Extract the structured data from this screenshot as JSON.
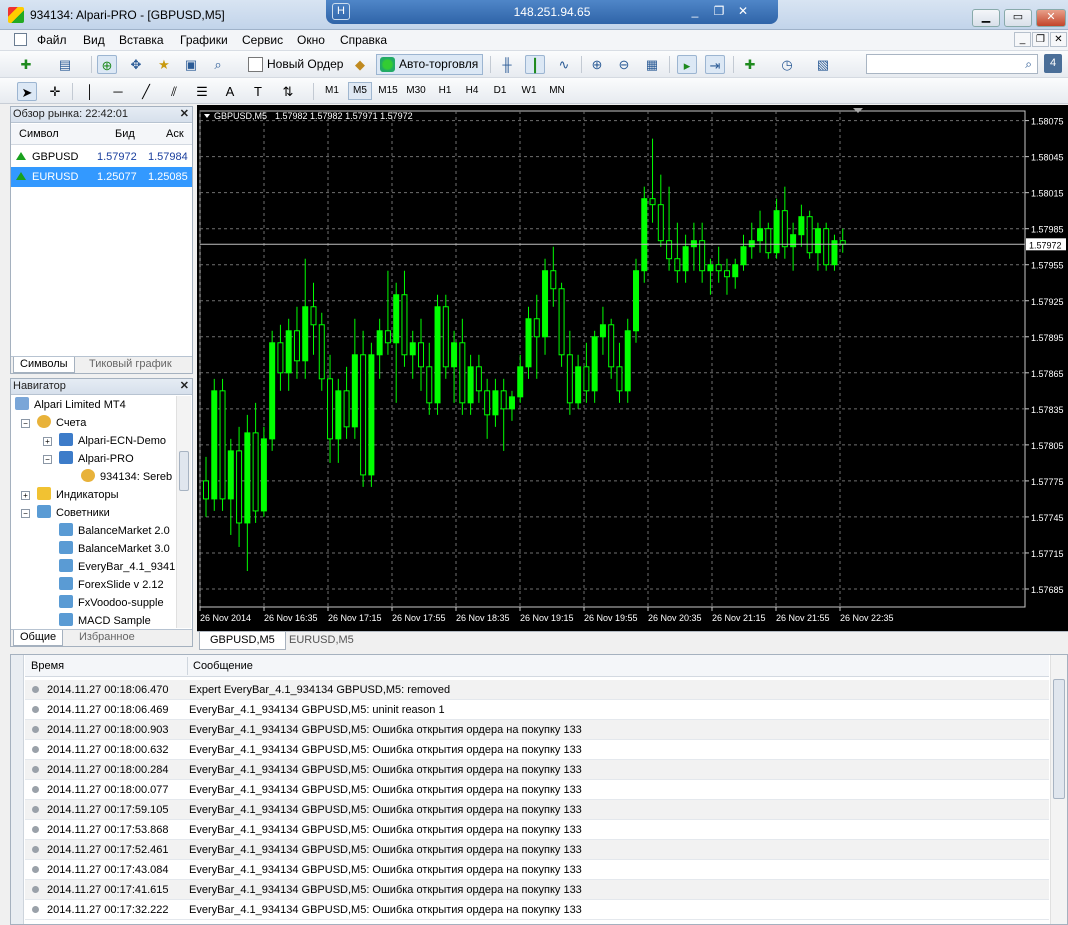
{
  "window": {
    "title": "934134: Alpari-PRO - [GBPUSD,M5]",
    "remote_ip": "148.251.94.65"
  },
  "menu": [
    "Файл",
    "Вид",
    "Вставка",
    "Графики",
    "Сервис",
    "Окно",
    "Справка"
  ],
  "toolbar": {
    "new_order": "Новый Ордер",
    "auto_trading": "Авто-торговля",
    "badge": "4"
  },
  "timeframes": [
    "M1",
    "M5",
    "M15",
    "M30",
    "H1",
    "H4",
    "D1",
    "W1",
    "MN"
  ],
  "active_timeframe": "M5",
  "market_watch": {
    "title": "Обзор рынка: 22:42:01",
    "columns": {
      "symbol": "Символ",
      "bid": "Бид",
      "ask": "Аск"
    },
    "rows": [
      {
        "symbol": "GBPUSD",
        "bid": "1.57972",
        "ask": "1.57984"
      },
      {
        "symbol": "EURUSD",
        "bid": "1.25077",
        "ask": "1.25085"
      }
    ],
    "tabs": [
      "Символы",
      "Тиковый график"
    ]
  },
  "navigator": {
    "title": "Навигатор",
    "items": [
      {
        "label": "Alpari Limited MT4",
        "icon": "terminal-icon"
      },
      {
        "label": "Счета",
        "icon": "accounts-icon"
      },
      {
        "label": "Alpari-ECN-Demo",
        "icon": "server-icon"
      },
      {
        "label": "Alpari-PRO",
        "icon": "server-icon"
      },
      {
        "label": "934134: Sereb",
        "icon": "account-icon"
      },
      {
        "label": "Индикаторы",
        "icon": "indicators-icon"
      },
      {
        "label": "Советники",
        "icon": "experts-icon"
      },
      {
        "label": "BalanceMarket 2.0",
        "icon": "expert-icon"
      },
      {
        "label": "BalanceMarket 3.0",
        "icon": "expert-icon"
      },
      {
        "label": "EveryBar_4.1_9341",
        "icon": "expert-icon"
      },
      {
        "label": "ForexSlide v 2.12",
        "icon": "expert-icon"
      },
      {
        "label": "FxVoodoo-supple",
        "icon": "expert-icon"
      },
      {
        "label": "MACD Sample",
        "icon": "expert-icon"
      }
    ],
    "tabs": [
      "Общие",
      "Избранное"
    ]
  },
  "chart_tabs": [
    "GBPUSD,M5",
    "EURUSD,M5"
  ],
  "chart_data": {
    "type": "candlestick",
    "title": "GBPUSD,M5  1.57982 1.57982 1.57971 1.57972",
    "symbol": "GBPUSD,M5",
    "ohlc_header": "1.57982 1.57982 1.57971 1.57972",
    "current_price": "1.57972",
    "y_ticks": [
      "1.58075",
      "1.58045",
      "1.58015",
      "1.57985",
      "1.57955",
      "1.57925",
      "1.57895",
      "1.57865",
      "1.57835",
      "1.57805",
      "1.57775",
      "1.57745",
      "1.57715",
      "1.57685"
    ],
    "x_ticks": [
      "26 Nov 2014",
      "26 Nov 16:35",
      "26 Nov 17:15",
      "26 Nov 17:55",
      "26 Nov 18:35",
      "26 Nov 19:15",
      "26 Nov 19:55",
      "26 Nov 20:35",
      "26 Nov 21:15",
      "26 Nov 21:55",
      "26 Nov 22:35"
    ],
    "ylim": [
      1.5767,
      1.58083
    ],
    "grid": true,
    "colors": {
      "bull": "#00ff00",
      "bear": "#000000",
      "wick": "#00ff00",
      "grid": "#707070",
      "bidline": "#c0c0c0"
    },
    "candles": [
      {
        "o": 1.57775,
        "h": 1.57795,
        "l": 1.57745,
        "c": 1.5776
      },
      {
        "o": 1.5776,
        "h": 1.5786,
        "l": 1.5775,
        "c": 1.5785
      },
      {
        "o": 1.5785,
        "h": 1.5786,
        "l": 1.5775,
        "c": 1.5776
      },
      {
        "o": 1.5776,
        "h": 1.5781,
        "l": 1.5773,
        "c": 1.578
      },
      {
        "o": 1.578,
        "h": 1.5782,
        "l": 1.5772,
        "c": 1.5774
      },
      {
        "o": 1.5774,
        "h": 1.5783,
        "l": 1.577,
        "c": 1.57815
      },
      {
        "o": 1.57815,
        "h": 1.5784,
        "l": 1.5774,
        "c": 1.5775
      },
      {
        "o": 1.5775,
        "h": 1.5782,
        "l": 1.57745,
        "c": 1.5781
      },
      {
        "o": 1.5781,
        "h": 1.579,
        "l": 1.578,
        "c": 1.5789
      },
      {
        "o": 1.5789,
        "h": 1.57905,
        "l": 1.5785,
        "c": 1.57865
      },
      {
        "o": 1.57865,
        "h": 1.5791,
        "l": 1.5785,
        "c": 1.579
      },
      {
        "o": 1.579,
        "h": 1.5792,
        "l": 1.5786,
        "c": 1.57875
      },
      {
        "o": 1.57875,
        "h": 1.5796,
        "l": 1.5786,
        "c": 1.5792
      },
      {
        "o": 1.5792,
        "h": 1.5794,
        "l": 1.5788,
        "c": 1.57905
      },
      {
        "o": 1.57905,
        "h": 1.57915,
        "l": 1.5785,
        "c": 1.5786
      },
      {
        "o": 1.5786,
        "h": 1.5788,
        "l": 1.5779,
        "c": 1.5781
      },
      {
        "o": 1.5781,
        "h": 1.5786,
        "l": 1.5779,
        "c": 1.5785
      },
      {
        "o": 1.5785,
        "h": 1.5787,
        "l": 1.5781,
        "c": 1.5782
      },
      {
        "o": 1.5782,
        "h": 1.5791,
        "l": 1.5781,
        "c": 1.5788
      },
      {
        "o": 1.5788,
        "h": 1.579,
        "l": 1.5777,
        "c": 1.5778
      },
      {
        "o": 1.5778,
        "h": 1.5789,
        "l": 1.5777,
        "c": 1.5788
      },
      {
        "o": 1.5788,
        "h": 1.5791,
        "l": 1.5786,
        "c": 1.579
      },
      {
        "o": 1.579,
        "h": 1.5795,
        "l": 1.5788,
        "c": 1.5789
      },
      {
        "o": 1.5789,
        "h": 1.5794,
        "l": 1.5784,
        "c": 1.5793
      },
      {
        "o": 1.5793,
        "h": 1.5795,
        "l": 1.5787,
        "c": 1.5788
      },
      {
        "o": 1.5788,
        "h": 1.579,
        "l": 1.5786,
        "c": 1.5789
      },
      {
        "o": 1.5789,
        "h": 1.5791,
        "l": 1.5785,
        "c": 1.5787
      },
      {
        "o": 1.5787,
        "h": 1.5789,
        "l": 1.5783,
        "c": 1.5784
      },
      {
        "o": 1.5784,
        "h": 1.5793,
        "l": 1.5783,
        "c": 1.5792
      },
      {
        "o": 1.5792,
        "h": 1.5793,
        "l": 1.5786,
        "c": 1.5787
      },
      {
        "o": 1.5787,
        "h": 1.579,
        "l": 1.5784,
        "c": 1.5789
      },
      {
        "o": 1.5789,
        "h": 1.5791,
        "l": 1.5783,
        "c": 1.5784
      },
      {
        "o": 1.5784,
        "h": 1.5788,
        "l": 1.5783,
        "c": 1.5787
      },
      {
        "o": 1.5787,
        "h": 1.5788,
        "l": 1.5784,
        "c": 1.5785
      },
      {
        "o": 1.5785,
        "h": 1.5786,
        "l": 1.5781,
        "c": 1.5783
      },
      {
        "o": 1.5783,
        "h": 1.5786,
        "l": 1.5782,
        "c": 1.5785
      },
      {
        "o": 1.5785,
        "h": 1.5786,
        "l": 1.578,
        "c": 1.57835
      },
      {
        "o": 1.57835,
        "h": 1.5785,
        "l": 1.57825,
        "c": 1.57845
      },
      {
        "o": 1.57845,
        "h": 1.5788,
        "l": 1.5784,
        "c": 1.5787
      },
      {
        "o": 1.5787,
        "h": 1.5792,
        "l": 1.5786,
        "c": 1.5791
      },
      {
        "o": 1.5791,
        "h": 1.5793,
        "l": 1.5786,
        "c": 1.57895
      },
      {
        "o": 1.57895,
        "h": 1.5796,
        "l": 1.5788,
        "c": 1.5795
      },
      {
        "o": 1.5795,
        "h": 1.5797,
        "l": 1.5792,
        "c": 1.57935
      },
      {
        "o": 1.57935,
        "h": 1.5794,
        "l": 1.5787,
        "c": 1.5788
      },
      {
        "o": 1.5788,
        "h": 1.579,
        "l": 1.5783,
        "c": 1.5784
      },
      {
        "o": 1.5784,
        "h": 1.5788,
        "l": 1.57835,
        "c": 1.5787
      },
      {
        "o": 1.5787,
        "h": 1.5789,
        "l": 1.5784,
        "c": 1.5785
      },
      {
        "o": 1.5785,
        "h": 1.579,
        "l": 1.5784,
        "c": 1.57895
      },
      {
        "o": 1.57895,
        "h": 1.5792,
        "l": 1.5788,
        "c": 1.57905
      },
      {
        "o": 1.57905,
        "h": 1.5791,
        "l": 1.5786,
        "c": 1.5787
      },
      {
        "o": 1.5787,
        "h": 1.5789,
        "l": 1.5784,
        "c": 1.5785
      },
      {
        "o": 1.5785,
        "h": 1.5791,
        "l": 1.5784,
        "c": 1.579
      },
      {
        "o": 1.579,
        "h": 1.5796,
        "l": 1.5789,
        "c": 1.5795
      },
      {
        "o": 1.5795,
        "h": 1.5802,
        "l": 1.5794,
        "c": 1.5801
      },
      {
        "o": 1.5801,
        "h": 1.5806,
        "l": 1.5799,
        "c": 1.58005
      },
      {
        "o": 1.58005,
        "h": 1.5803,
        "l": 1.5797,
        "c": 1.57975
      },
      {
        "o": 1.57975,
        "h": 1.5802,
        "l": 1.5795,
        "c": 1.5796
      },
      {
        "o": 1.5796,
        "h": 1.5799,
        "l": 1.5794,
        "c": 1.5795
      },
      {
        "o": 1.5795,
        "h": 1.5798,
        "l": 1.5794,
        "c": 1.5797
      },
      {
        "o": 1.5797,
        "h": 1.5799,
        "l": 1.5795,
        "c": 1.57975
      },
      {
        "o": 1.57975,
        "h": 1.5799,
        "l": 1.5794,
        "c": 1.5795
      },
      {
        "o": 1.5795,
        "h": 1.5796,
        "l": 1.5793,
        "c": 1.57955
      },
      {
        "o": 1.57955,
        "h": 1.5797,
        "l": 1.5794,
        "c": 1.5795
      },
      {
        "o": 1.5795,
        "h": 1.5796,
        "l": 1.5793,
        "c": 1.57945
      },
      {
        "o": 1.57945,
        "h": 1.5796,
        "l": 1.57935,
        "c": 1.57955
      },
      {
        "o": 1.57955,
        "h": 1.5798,
        "l": 1.5795,
        "c": 1.5797
      },
      {
        "o": 1.5797,
        "h": 1.5799,
        "l": 1.5796,
        "c": 1.57975
      },
      {
        "o": 1.57975,
        "h": 1.58,
        "l": 1.57965,
        "c": 1.57985
      },
      {
        "o": 1.57985,
        "h": 1.5799,
        "l": 1.5796,
        "c": 1.57965
      },
      {
        "o": 1.57965,
        "h": 1.5801,
        "l": 1.5796,
        "c": 1.58
      },
      {
        "o": 1.58,
        "h": 1.5802,
        "l": 1.5796,
        "c": 1.5797
      },
      {
        "o": 1.5797,
        "h": 1.5799,
        "l": 1.5795,
        "c": 1.5798
      },
      {
        "o": 1.5798,
        "h": 1.58005,
        "l": 1.5797,
        "c": 1.57995
      },
      {
        "o": 1.57995,
        "h": 1.58,
        "l": 1.5796,
        "c": 1.57965
      },
      {
        "o": 1.57965,
        "h": 1.5799,
        "l": 1.5795,
        "c": 1.57985
      },
      {
        "o": 1.57985,
        "h": 1.5799,
        "l": 1.5795,
        "c": 1.57955
      },
      {
        "o": 1.57955,
        "h": 1.5798,
        "l": 1.5795,
        "c": 1.57975
      },
      {
        "o": 1.57975,
        "h": 1.57985,
        "l": 1.57965,
        "c": 1.57972
      }
    ]
  },
  "log": {
    "columns": {
      "time": "Время",
      "message": "Сообщение"
    },
    "rows": [
      {
        "time": "2014.11.27 00:18:06.470",
        "message": "Expert EveryBar_4.1_934134 GBPUSD,M5: removed"
      },
      {
        "time": "2014.11.27 00:18:06.469",
        "message": "EveryBar_4.1_934134 GBPUSD,M5: uninit reason 1"
      },
      {
        "time": "2014.11.27 00:18:00.903",
        "message": "EveryBar_4.1_934134 GBPUSD,M5: Ошибка открытия ордера на покупку 133"
      },
      {
        "time": "2014.11.27 00:18:00.632",
        "message": "EveryBar_4.1_934134 GBPUSD,M5: Ошибка открытия ордера на покупку 133"
      },
      {
        "time": "2014.11.27 00:18:00.284",
        "message": "EveryBar_4.1_934134 GBPUSD,M5: Ошибка открытия ордера на покупку 133"
      },
      {
        "time": "2014.11.27 00:18:00.077",
        "message": "EveryBar_4.1_934134 GBPUSD,M5: Ошибка открытия ордера на покупку 133"
      },
      {
        "time": "2014.11.27 00:17:59.105",
        "message": "EveryBar_4.1_934134 GBPUSD,M5: Ошибка открытия ордера на покупку 133"
      },
      {
        "time": "2014.11.27 00:17:53.868",
        "message": "EveryBar_4.1_934134 GBPUSD,M5: Ошибка открытия ордера на покупку 133"
      },
      {
        "time": "2014.11.27 00:17:52.461",
        "message": "EveryBar_4.1_934134 GBPUSD,M5: Ошибка открытия ордера на покупку 133"
      },
      {
        "time": "2014.11.27 00:17:43.084",
        "message": "EveryBar_4.1_934134 GBPUSD,M5: Ошибка открытия ордера на покупку 133"
      },
      {
        "time": "2014.11.27 00:17:41.615",
        "message": "EveryBar_4.1_934134 GBPUSD,M5: Ошибка открытия ордера на покупку 133"
      },
      {
        "time": "2014.11.27 00:17:32.222",
        "message": "EveryBar_4.1_934134 GBPUSD,M5: Ошибка открытия ордера на покупку 133"
      }
    ]
  }
}
